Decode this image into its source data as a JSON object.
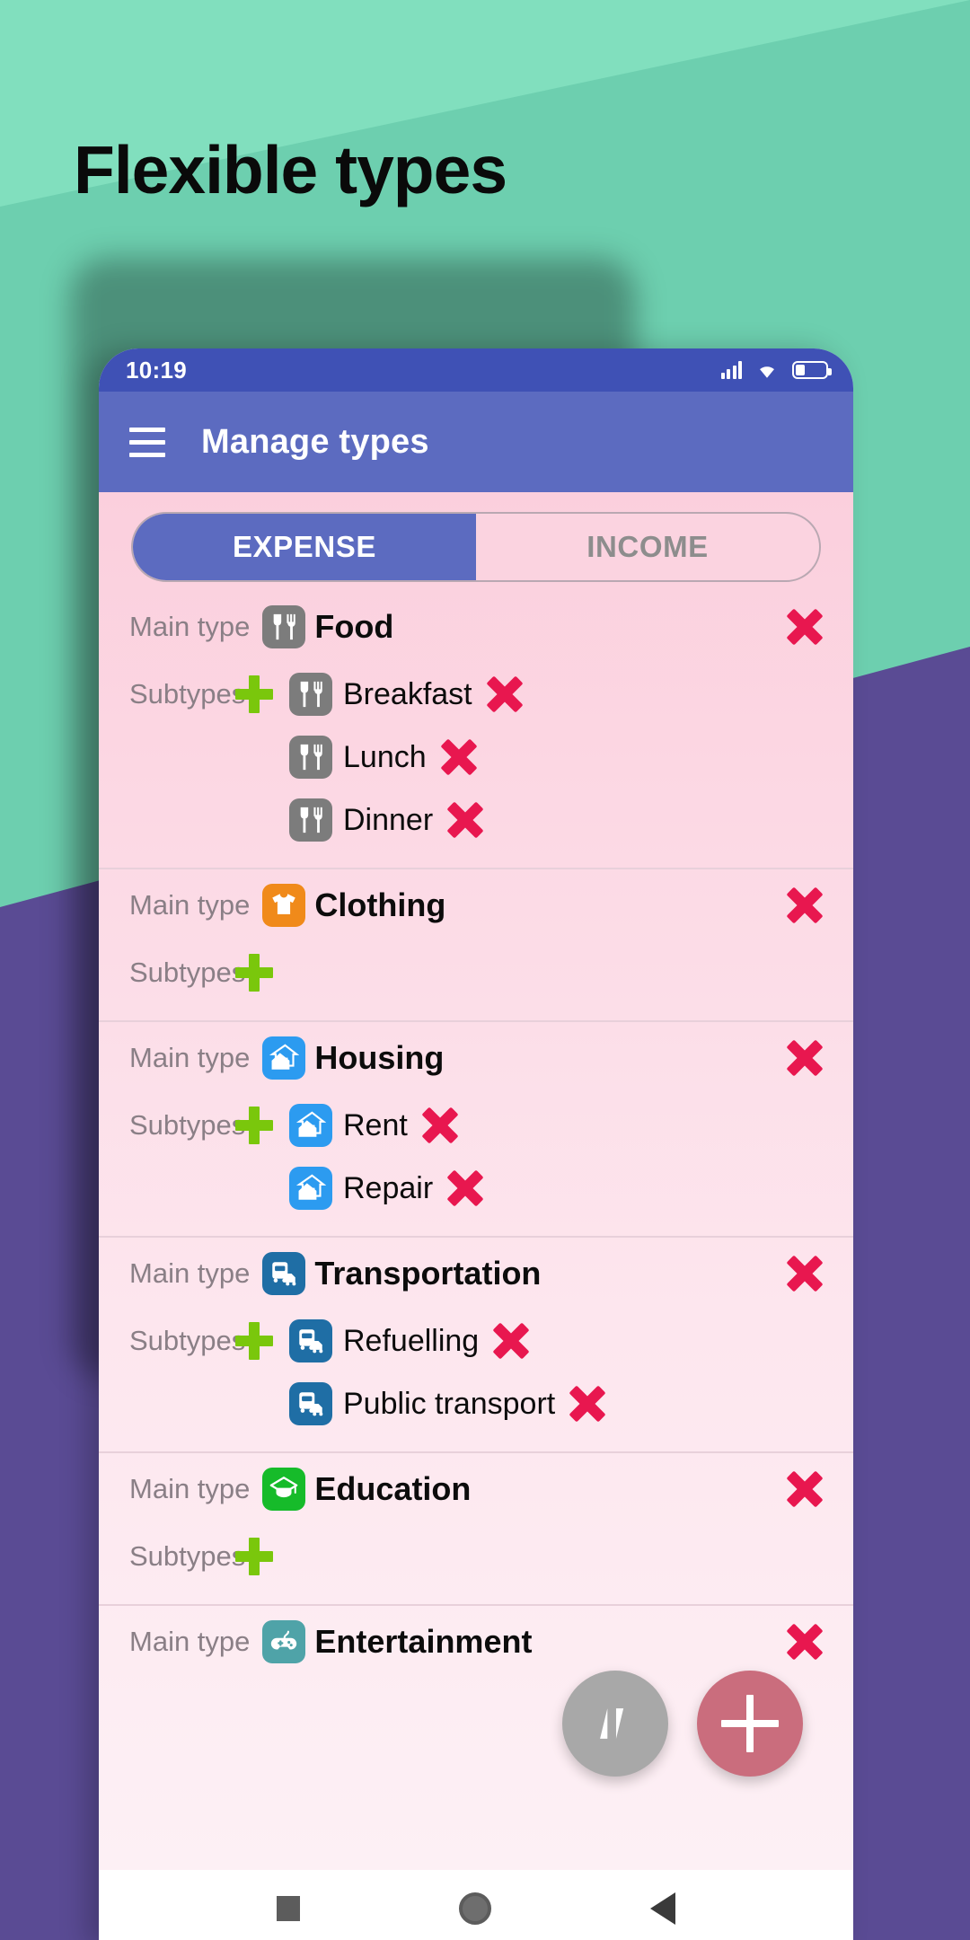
{
  "promo": {
    "headline": "Flexible types",
    "bg_teal": "#6dcfaf",
    "bg_teal_light": "#81dfbe",
    "bg_purple": "#5a4b94"
  },
  "status_bar": {
    "time": "10:19",
    "signal_icon": "signal-bars-icon",
    "wifi_icon": "wifi-icon",
    "battery_icon": "battery-icon"
  },
  "app_bar": {
    "menu_icon": "hamburger-menu-icon",
    "title": "Manage types",
    "color": "#5c6bc0"
  },
  "tabs": [
    {
      "label": "EXPENSE",
      "selected": true
    },
    {
      "label": "INCOME",
      "selected": false
    }
  ],
  "labels": {
    "main_type": "Main type",
    "subtypes": "Subtypes"
  },
  "groups": [
    {
      "name": "Food",
      "icon": "cutlery-icon",
      "icon_color": "#7c7c7c",
      "subtypes": [
        {
          "name": "Breakfast",
          "icon": "cutlery-icon"
        },
        {
          "name": "Lunch",
          "icon": "cutlery-icon"
        },
        {
          "name": "Dinner",
          "icon": "cutlery-icon"
        }
      ]
    },
    {
      "name": "Clothing",
      "icon": "tshirt-icon",
      "icon_color": "#f08a1a",
      "subtypes": []
    },
    {
      "name": "Housing",
      "icon": "house-icon",
      "icon_color": "#2c9bf0",
      "subtypes": [
        {
          "name": "Rent",
          "icon": "house-icon"
        },
        {
          "name": "Repair",
          "icon": "house-icon"
        }
      ]
    },
    {
      "name": "Transportation",
      "icon": "bus-car-icon",
      "icon_color": "#1f6ea5",
      "subtypes": [
        {
          "name": "Refuelling",
          "icon": "bus-car-icon"
        },
        {
          "name": "Public transport",
          "icon": "bus-car-icon"
        }
      ]
    },
    {
      "name": "Education",
      "icon": "graduation-cap-icon",
      "icon_color": "#16bb2a",
      "subtypes": []
    },
    {
      "name": "Entertainment",
      "icon": "gamepad-icon",
      "icon_color": "#4fa3a8",
      "subtypes": []
    }
  ],
  "fabs": {
    "sort_icon": "sort-updown-icon",
    "sort_color": "#a8a8a8",
    "add_icon": "plus-icon",
    "add_color": "#ca6d7d"
  },
  "nav_bar": {
    "recents_icon": "square-recents-icon",
    "home_icon": "circle-home-icon",
    "back_icon": "triangle-back-icon"
  },
  "colors": {
    "delete": "#e8174f",
    "add": "#7ac70c",
    "accent": "#5c6bc0",
    "label_gray": "#8a7f86"
  }
}
